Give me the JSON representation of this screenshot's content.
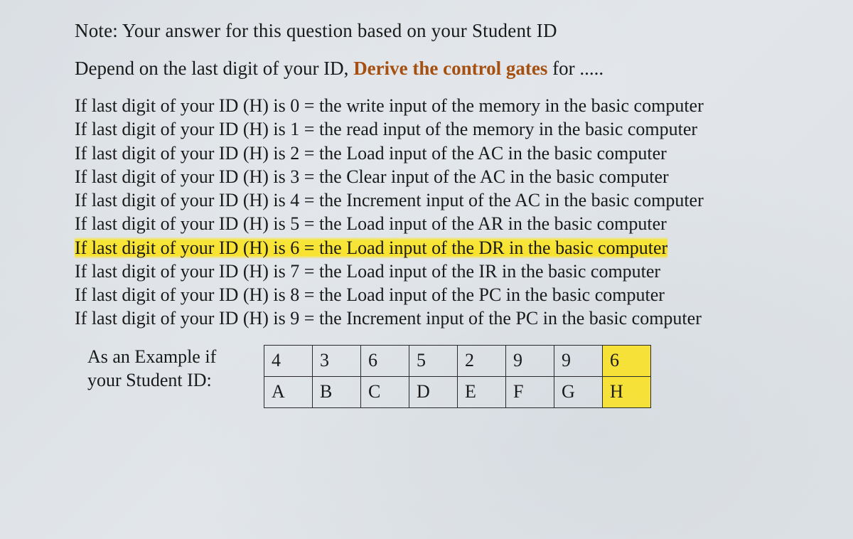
{
  "note": "Note: Your answer for this question based on your Student ID",
  "depend_prefix": "Depend on the last digit of your ID, ",
  "depend_emphasis": "Derive the control gates",
  "depend_suffix": " for .....",
  "conditions": [
    {
      "text": "If last digit of your ID (H) is 0 = the write input of the memory in the basic computer",
      "highlight": false
    },
    {
      "text": "If last digit of your ID (H) is 1 = the read input of the memory in the basic computer",
      "highlight": false
    },
    {
      "text": "If last digit of your ID (H) is 2 = the Load input of the AC in the basic computer",
      "highlight": false
    },
    {
      "text": "If last digit of your ID (H) is 3 = the Clear input of the AC in the basic computer",
      "highlight": false
    },
    {
      "text": "If last digit of your ID (H) is 4 = the Increment input of the AC in the basic computer",
      "highlight": false
    },
    {
      "text": "If last digit of your ID (H) is 5 = the Load input of the AR in the basic computer",
      "highlight": false
    },
    {
      "text": "If last digit of your ID (H) is 6 = the Load input of the DR in the basic computer",
      "highlight": true
    },
    {
      "text": "If last digit of your ID (H) is 7 = the Load input of the IR in the basic computer",
      "highlight": false
    },
    {
      "text": "If last digit of your ID (H) is 8 = the Load input of the PC in the basic computer",
      "highlight": false
    },
    {
      "text": "If last digit of your ID (H) is 9 = the Increment input of the PC in the basic computer",
      "highlight": false
    }
  ],
  "example_label_line1": "As an Example  if",
  "example_label_line2": "your Student ID:",
  "table": {
    "row1": [
      "4",
      "3",
      "6",
      "5",
      "2",
      "9",
      "9",
      "6"
    ],
    "row2": [
      "A",
      "B",
      "C",
      "D",
      "E",
      "F",
      "G",
      "H"
    ],
    "highlight_col": 7
  }
}
